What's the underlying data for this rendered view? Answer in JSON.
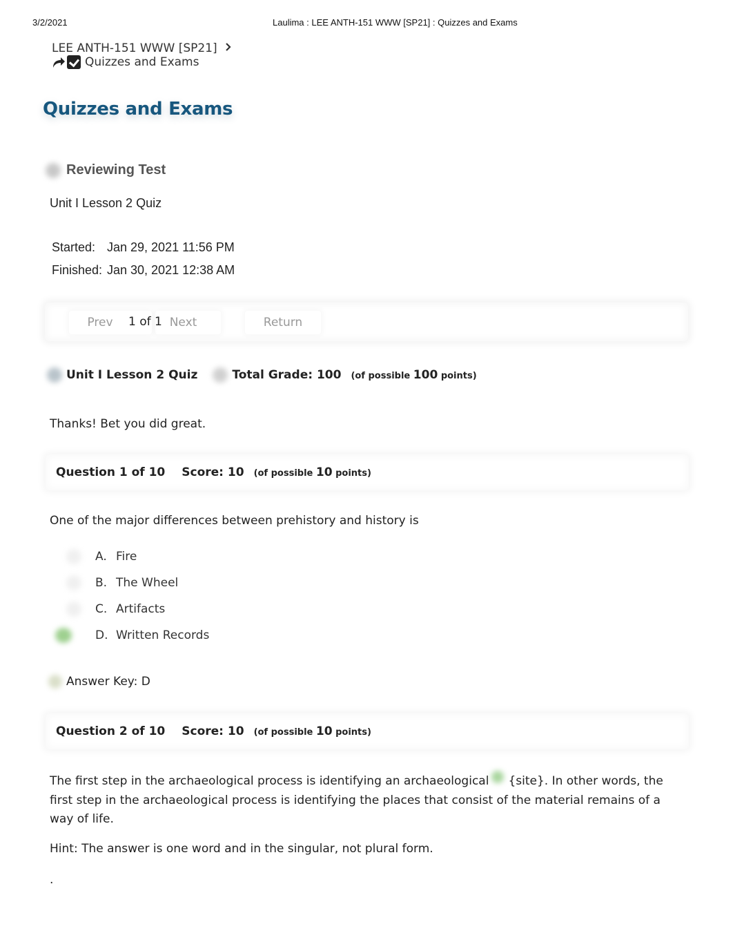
{
  "print_header": {
    "date": "3/2/2021",
    "title": "Laulima : LEE ANTH-151 WWW [SP21] : Quizzes and Exams"
  },
  "breadcrumb": {
    "course": "LEE ANTH-151 WWW [SP21]",
    "separator_icon": "chevron-right-icon",
    "current": "Quizzes and Exams"
  },
  "page": {
    "title": "Quizzes and Exams",
    "title_color": "#17577e"
  },
  "review": {
    "heading": "Reviewing Test",
    "quiz_name": "Unit I Lesson 2 Quiz",
    "started_label": "Started:",
    "started_value": "Jan 29, 2021 11:56 PM",
    "finished_label": "Finished:",
    "finished_value": "Jan 30, 2021 12:38 AM"
  },
  "nav": {
    "prev": "Prev",
    "page_indicator": "1 of 1",
    "next": "Next",
    "return": "Return"
  },
  "grade": {
    "quiz_title": "Unit I Lesson 2 Quiz",
    "total_label": "Total Grade: 100",
    "of_possible_prefix": "(of possible",
    "possible": "100",
    "points_suffix": "points)"
  },
  "feedback": "Thanks! Bet you did great.",
  "questions": [
    {
      "header": "Question 1 of 10",
      "score": "Score: 10",
      "of_possible_prefix": "(of possible",
      "possible": "10",
      "points_suffix": "points)",
      "text": "One of the major differences between prehistory and history is",
      "options": [
        {
          "letter": "A.",
          "text": "Fire",
          "selected": false
        },
        {
          "letter": "B.",
          "text": "The Wheel",
          "selected": false
        },
        {
          "letter": "C.",
          "text": "Artifacts",
          "selected": false
        },
        {
          "letter": "D.",
          "text": "Written Records",
          "selected": true
        }
      ],
      "answer_key": "Answer Key: D"
    },
    {
      "header": "Question 2 of 10",
      "score": "Score: 10",
      "of_possible_prefix": "(of possible",
      "possible": "10",
      "points_suffix": "points)",
      "text_before": "The first step in the archaeological process is identifying an archaeological",
      "text_after": "{site}. In other words, the first step in the archaeological process is identifying the places that consist of the material remains of a way of life.",
      "hint": "Hint: The answer is one word and in the singular, not plural form.",
      "trailing": "."
    }
  ],
  "colors": {
    "correct_indicator": "#9ed08f"
  }
}
